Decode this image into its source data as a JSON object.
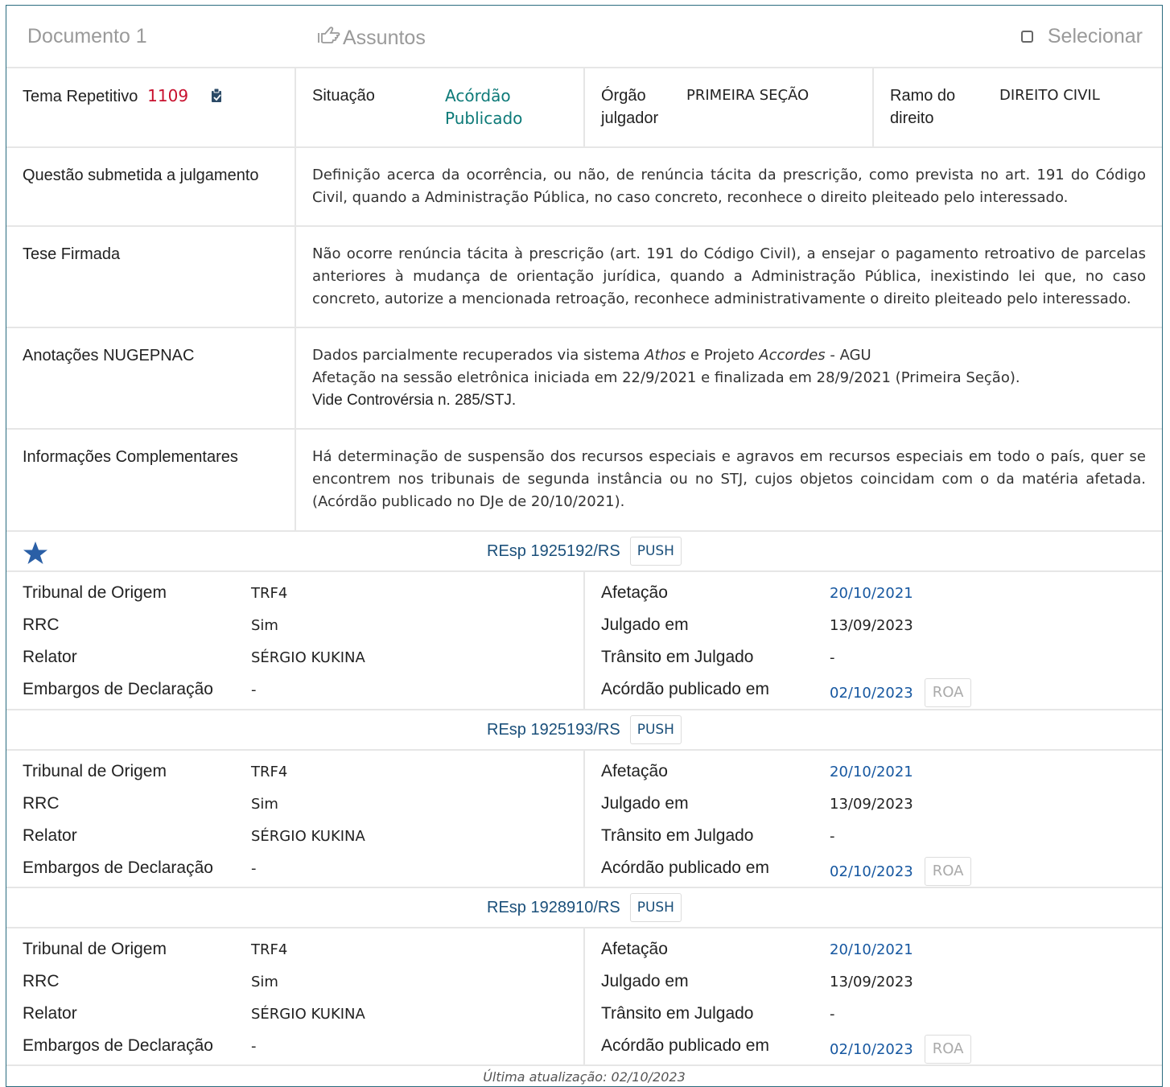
{
  "topbar": {
    "document_title": "Documento 1",
    "assuntos_label": "Assuntos",
    "assuntos_icon": "hand-pointer-icon",
    "select_label": "Selecionar"
  },
  "summary": {
    "tema_label": "Tema Repetitivo",
    "tema_number": "1109",
    "situacao_label": "Situação",
    "situacao_value_line1": "Acórdão",
    "situacao_value_line2": "Publicado",
    "orgao_label_line1": "Órgão",
    "orgao_label_line2": "julgador",
    "orgao_value": "PRIMEIRA SEÇÃO",
    "ramo_label_line1": "Ramo do",
    "ramo_label_line2": "direito",
    "ramo_value": "DIREITO CIVIL"
  },
  "sections": {
    "questao_label": "Questão submetida a julgamento",
    "questao_text": "Definição acerca da ocorrência, ou não, de renúncia tácita da prescrição, como prevista no art. 191 do Código Civil, quando a Administração Pública, no caso concreto, reconhece o direito pleiteado pelo interessado.",
    "tese_label": "Tese Firmada",
    "tese_text": "Não ocorre renúncia tácita à prescrição (art. 191 do Código Civil), a ensejar o pagamento retroativo de parcelas anteriores à mudança de orientação jurídica, quando a Administração Pública, inexistindo lei que, no caso concreto, autorize a mencionada retroação, reconhece administrativamente o direito pleiteado pelo interessado.",
    "anotacoes_label": "Anotações NUGEPNAC",
    "anotacoes_line1_pre": "Dados parcialmente recuperados via sistema ",
    "anotacoes_line1_em1": "Athos",
    "anotacoes_line1_mid": " e Projeto ",
    "anotacoes_line1_em2": "Accordes",
    "anotacoes_line1_post": " - AGU",
    "anotacoes_line2": "Afetação na sessão eletrônica iniciada em 22/9/2021 e finalizada em 28/9/2021 (Primeira Seção).",
    "anotacoes_line3": "Vide Controvérsia n. 285/STJ.",
    "info_label": "Informações Complementares",
    "info_text": "Há determinação de suspensão dos recursos especiais e agravos em recursos especiais em todo o país, quer se encontrem nos tribunais de segunda instância ou no STJ, cujos objetos coincidam com o da matéria afetada. (Acórdão publicado no DJe de 20/10/2021)."
  },
  "field_labels": {
    "tribunal": "Tribunal de Origem",
    "rrc": "RRC",
    "relator": "Relator",
    "embargos": "Embargos de Declaração",
    "afetacao": "Afetação",
    "julgado": "Julgado em",
    "transito": "Trânsito em Julgado",
    "acordao": "Acórdão publicado em",
    "push": "PUSH",
    "roa": "ROA"
  },
  "processes": [
    {
      "title": "REsp 1925192/RS",
      "tribunal": "TRF4",
      "rrc": "Sim",
      "relator": "SÉRGIO KUKINA",
      "embargos": "-",
      "afetacao": "20/10/2021",
      "julgado": "13/09/2023",
      "transito": "-",
      "acordao": "02/10/2023"
    },
    {
      "title": "REsp 1925193/RS",
      "tribunal": "TRF4",
      "rrc": "Sim",
      "relator": "SÉRGIO KUKINA",
      "embargos": "-",
      "afetacao": "20/10/2021",
      "julgado": "13/09/2023",
      "transito": "-",
      "acordao": "02/10/2023"
    },
    {
      "title": "REsp 1928910/RS",
      "tribunal": "TRF4",
      "rrc": "Sim",
      "relator": "SÉRGIO KUKINA",
      "embargos": "-",
      "afetacao": "20/10/2021",
      "julgado": "13/09/2023",
      "transito": "-",
      "acordao": "02/10/2023"
    }
  ],
  "footer": "Última atualização: 02/10/2023",
  "colors": {
    "border": "#2a6b7f",
    "teal": "#0d7a78",
    "red": "#c8102e",
    "link_blue": "#1657a0",
    "star_blue": "#2a5fa6"
  }
}
